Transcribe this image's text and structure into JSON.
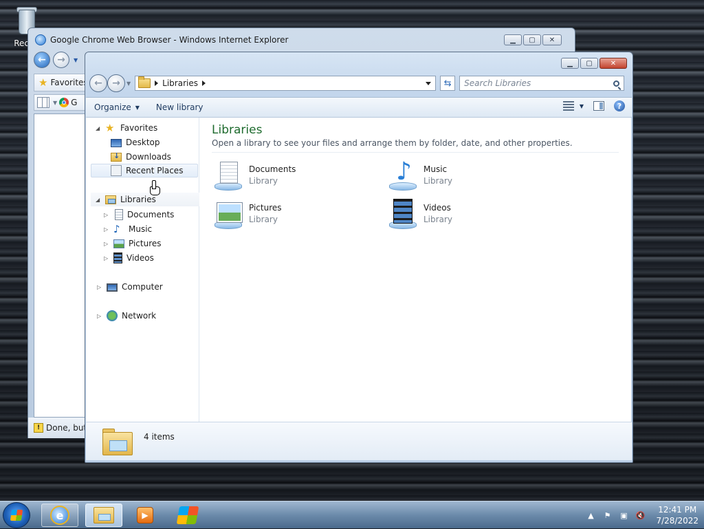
{
  "desktop": {
    "recycle_bin_label": "Recyc"
  },
  "ie_window": {
    "title": "Google Chrome Web Browser - Windows Internet Explorer",
    "favorites_label": "Favorites",
    "tab_label": "G",
    "status_text": "Done, but"
  },
  "explorer": {
    "address": {
      "path_item": "Libraries"
    },
    "search": {
      "placeholder": "Search Libraries"
    },
    "commands": {
      "organize": "Organize",
      "new_library": "New library"
    },
    "nav": {
      "favorites": "Favorites",
      "desktop": "Desktop",
      "downloads": "Downloads",
      "recent_places": "Recent Places",
      "libraries": "Libraries",
      "documents": "Documents",
      "music": "Music",
      "pictures": "Pictures",
      "videos": "Videos",
      "computer": "Computer",
      "network": "Network"
    },
    "content": {
      "title": "Libraries",
      "subtitle": "Open a library to see your files and arrange them by folder, date, and other properties.",
      "libraries": [
        {
          "name": "Documents",
          "kind": "Library",
          "icon": "documents-library-icon"
        },
        {
          "name": "Music",
          "kind": "Library",
          "icon": "music-library-icon"
        },
        {
          "name": "Pictures",
          "kind": "Library",
          "icon": "pictures-library-icon"
        },
        {
          "name": "Videos",
          "kind": "Library",
          "icon": "videos-library-icon"
        }
      ]
    },
    "details": {
      "item_count": "4 items"
    }
  },
  "taskbar": {
    "time": "12:41 PM",
    "date": "7/28/2022"
  },
  "colors": {
    "library_title": "#1e6b2e",
    "taskbar": "#4a6a8c"
  }
}
